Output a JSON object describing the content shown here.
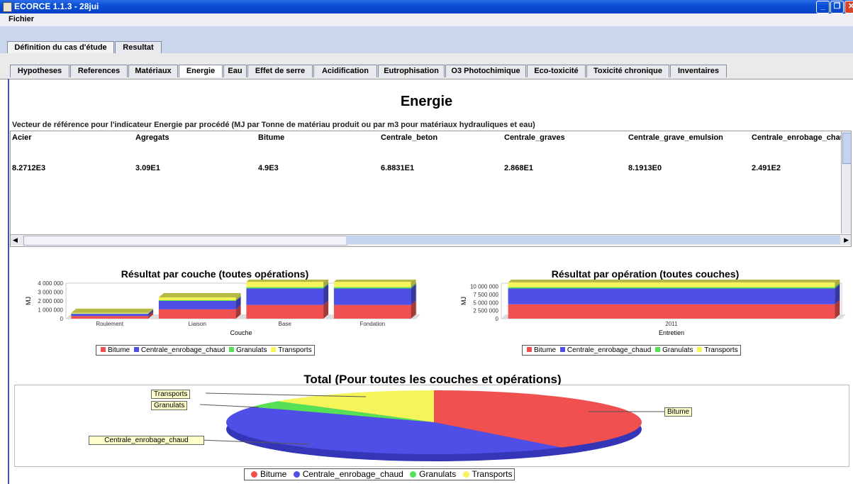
{
  "window": {
    "title": "ECORCE 1.1.3 - 28jui"
  },
  "menu": {
    "file": "Fichier"
  },
  "top_tabs": [
    {
      "label": "Définition du cas d'étude"
    },
    {
      "label": "Resultat"
    }
  ],
  "sub_tabs": [
    {
      "label": "Hypotheses"
    },
    {
      "label": "References"
    },
    {
      "label": "Matériaux"
    },
    {
      "label": "Energie"
    },
    {
      "label": "Eau"
    },
    {
      "label": "Effet de serre"
    },
    {
      "label": "Acidification"
    },
    {
      "label": "Eutrophisation"
    },
    {
      "label": "O3 Photochimique"
    },
    {
      "label": "Eco-toxicité"
    },
    {
      "label": "Toxicité chronique"
    },
    {
      "label": "Inventaires"
    }
  ],
  "panel": {
    "heading": "Energie",
    "vector_label": "Vecteur de référence pour l'indicateur Energie par procédé (MJ par Tonne de matériau produit ou par m3 pour matériaux hydrauliques et eau)"
  },
  "reference_table": {
    "headers": [
      "Acier",
      "Agregats",
      "Bitume",
      "Centrale_beton",
      "Centrale_graves",
      "Centrale_grave_emulsion",
      "Centrale_enrobage_chau"
    ],
    "row": [
      "8.2712E3",
      "3.09E1",
      "4.9E3",
      "6.8831E1",
      "2.868E1",
      "8.1913E0",
      "2.491E2"
    ]
  },
  "legend": [
    "Bitume",
    "Centrale_enrobage_chaud",
    "Granulats",
    "Transports"
  ],
  "colors": {
    "bitume": "#f05050",
    "centrale": "#4f4fe8",
    "granulats": "#55e055",
    "transports": "#f5f55a",
    "accent": "#0a4fd4"
  },
  "chart_data": [
    {
      "type": "bar",
      "stacked": true,
      "title": "Résultat par couche (toutes opérations)",
      "xlabel": "Couche",
      "ylabel": "MJ",
      "ylim": [
        0,
        4000000
      ],
      "yticks": [
        "4 000 000",
        "3 000 000",
        "2 000 000",
        "1 000 000",
        "0"
      ],
      "categories": [
        "Roulement",
        "Liaison",
        "Base",
        "Fondation"
      ],
      "series": [
        {
          "name": "Bitume",
          "values": [
            300000,
            1050000,
            1550000,
            1550000
          ]
        },
        {
          "name": "Centrale_enrobage_chaud",
          "values": [
            250000,
            950000,
            1850000,
            1850000
          ]
        },
        {
          "name": "Granulats",
          "values": [
            30000,
            80000,
            150000,
            150000
          ]
        },
        {
          "name": "Transports",
          "values": [
            70000,
            320000,
            600000,
            600000
          ]
        }
      ]
    },
    {
      "type": "bar",
      "stacked": true,
      "title": "Résultat par opération (toutes couches)",
      "xlabel": "Entretien",
      "ylabel": "MJ",
      "ylim": [
        0,
        11000000
      ],
      "yticks": [
        "10 000 000",
        "7 500 000",
        "5 000 000",
        "2 500 000",
        "0"
      ],
      "categories": [
        "2011"
      ],
      "series": [
        {
          "name": "Bitume",
          "values": [
            4450000
          ]
        },
        {
          "name": "Centrale_enrobage_chaud",
          "values": [
            4900000
          ]
        },
        {
          "name": "Granulats",
          "values": [
            410000
          ]
        },
        {
          "name": "Transports",
          "values": [
            1500000
          ]
        }
      ]
    },
    {
      "type": "pie",
      "title": "Total (Pour toutes les couches et opérations)",
      "labels": [
        "Bitume",
        "Centrale_enrobage_chaud",
        "Granulats",
        "Transports"
      ],
      "callouts": [
        "Bitume",
        "Centrale_enrobage_chaud",
        "Granulats",
        "Transports"
      ],
      "values": [
        39.5,
        43.5,
        3.5,
        13.5
      ]
    }
  ]
}
